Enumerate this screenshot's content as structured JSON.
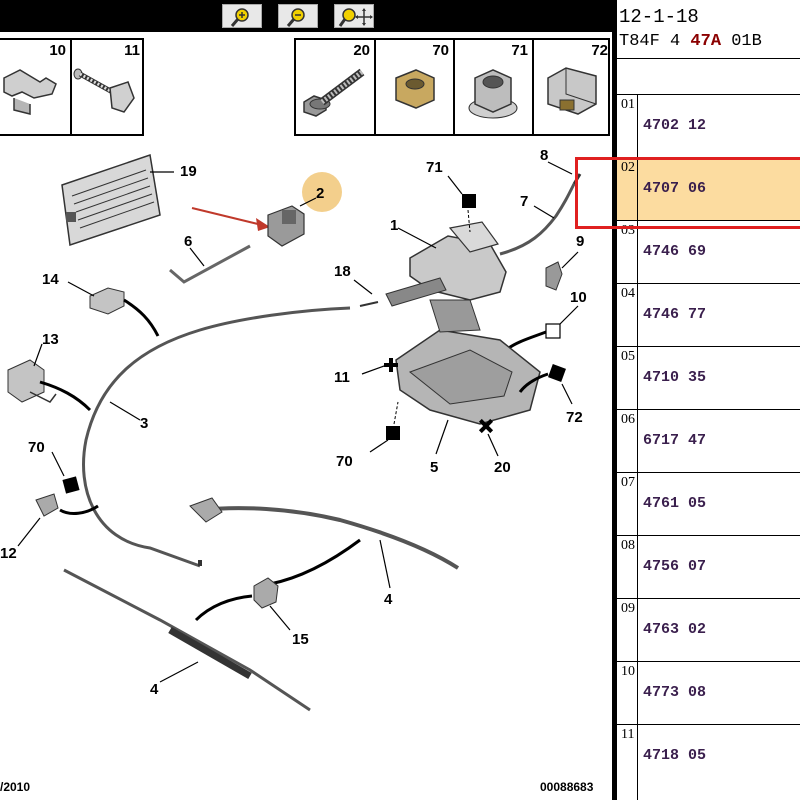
{
  "toolbar": {
    "buttons": [
      {
        "icon": "zoom-in-icon"
      },
      {
        "icon": "zoom-out-icon"
      },
      {
        "icon": "zoom-fit-icon"
      }
    ]
  },
  "left_parts": [
    {
      "num": "10",
      "icon": "clip-icon"
    },
    {
      "num": "11",
      "icon": "screw-icon"
    }
  ],
  "right_parts": [
    {
      "num": "20",
      "icon": "bolt-icon"
    },
    {
      "num": "70",
      "icon": "nut-icon"
    },
    {
      "num": "71",
      "icon": "flange-nut-icon"
    },
    {
      "num": "72",
      "icon": "cage-nut-icon"
    }
  ],
  "callouts": {
    "c19": "19",
    "c2": "2",
    "c6": "6",
    "c14": "14",
    "c13": "13",
    "c3": "3",
    "c70a": "70",
    "c12": "12",
    "c71": "71",
    "c8": "8",
    "c7": "7",
    "c1": "1",
    "c18": "18",
    "c9": "9",
    "c10": "10",
    "c11": "11",
    "c72": "72",
    "c70b": "70",
    "c5": "5",
    "c20": "20",
    "c4a": "4",
    "c15": "15",
    "c4b": "4"
  },
  "footer": {
    "date": "/2010",
    "ref": "00088683"
  },
  "panel": {
    "date": "12-1-18",
    "code_prefix": "T84F 4 ",
    "code_highlight": "47A",
    "code_suffix": " 01B",
    "rows": [
      {
        "idx": "01",
        "ref": "4702 12"
      },
      {
        "idx": "02",
        "ref": "4707 06",
        "selected": true
      },
      {
        "idx": "03",
        "ref": "4746 69"
      },
      {
        "idx": "04",
        "ref": "4746 77"
      },
      {
        "idx": "05",
        "ref": "4710 35"
      },
      {
        "idx": "06",
        "ref": "6717 47"
      },
      {
        "idx": "07",
        "ref": "4761 05"
      },
      {
        "idx": "08",
        "ref": "4756 07"
      },
      {
        "idx": "09",
        "ref": "4763 02"
      },
      {
        "idx": "10",
        "ref": "4773 08"
      },
      {
        "idx": "11",
        "ref": "4718 05"
      }
    ]
  },
  "colors": {
    "selection_border": "#e02020",
    "selection_fill": "#fcdca0",
    "arrow": "#c0392b",
    "highlight_circle": "#f3cf8c"
  }
}
